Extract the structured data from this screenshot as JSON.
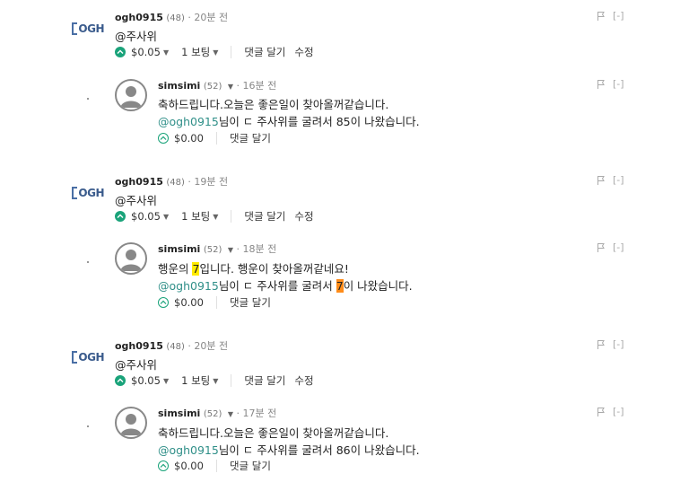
{
  "comments": [
    {
      "logo_text": "OGH",
      "user": "ogh0915",
      "rep": "(48)",
      "time": "· 20분 전",
      "body": "@주사위",
      "payout": "$0.05",
      "votes": "1 보팅",
      "reply": "댓글 달기",
      "edit": "수정",
      "hide": "[-]",
      "reply_item": {
        "user": "simsimi",
        "rep": "(52)",
        "time": "· 16분 전",
        "line1": "축하드립니다.오늘은 좋은일이 찾아올꺼같습니다.",
        "mention": "@ogh0915",
        "line2_rest": "님이 ㄷ 주사위를 굴려서 85이 나왔습니다.",
        "payout": "$0.00",
        "reply": "댓글 달기",
        "hide": "[-]"
      }
    },
    {
      "logo_text": "OGH",
      "user": "ogh0915",
      "rep": "(48)",
      "time": "· 19분 전",
      "body": "@주사위",
      "payout": "$0.05",
      "votes": "1 보팅",
      "reply": "댓글 달기",
      "edit": "수정",
      "hide": "[-]",
      "reply_item": {
        "user": "simsimi",
        "rep": "(52)",
        "time": "· 18분 전",
        "line1_a": "행운의 ",
        "line1_num": "7",
        "line1_b": "입니다. 행운이 찾아올꺼같네요!",
        "mention": "@ogh0915",
        "line2_a": "님이 ㄷ 주사위를 굴려서 ",
        "line2_num": "7",
        "line2_b": "이 나왔습니다.",
        "payout": "$0.00",
        "reply": "댓글 달기",
        "hide": "[-]"
      }
    },
    {
      "logo_text": "OGH",
      "user": "ogh0915",
      "rep": "(48)",
      "time": "· 20분 전",
      "body": "@주사위",
      "payout": "$0.05",
      "votes": "1 보팅",
      "reply": "댓글 달기",
      "edit": "수정",
      "hide": "[-]",
      "reply_item": {
        "user": "simsimi",
        "rep": "(52)",
        "time": "· 17분 전",
        "line1": "축하드립니다.오늘은 좋은일이 찾아올꺼같습니다.",
        "mention": "@ogh0915",
        "line2_rest": "님이 ㄷ 주사위를 굴려서 86이 나왔습니다.",
        "payout": "$0.00",
        "reply": "댓글 달기",
        "hide": "[-]"
      }
    }
  ],
  "colors": {
    "accent": "#1aa37a",
    "mention": "#2f8f88",
    "highlight_yellow": "#ffeb00",
    "highlight_orange": "#ff8c1a"
  }
}
